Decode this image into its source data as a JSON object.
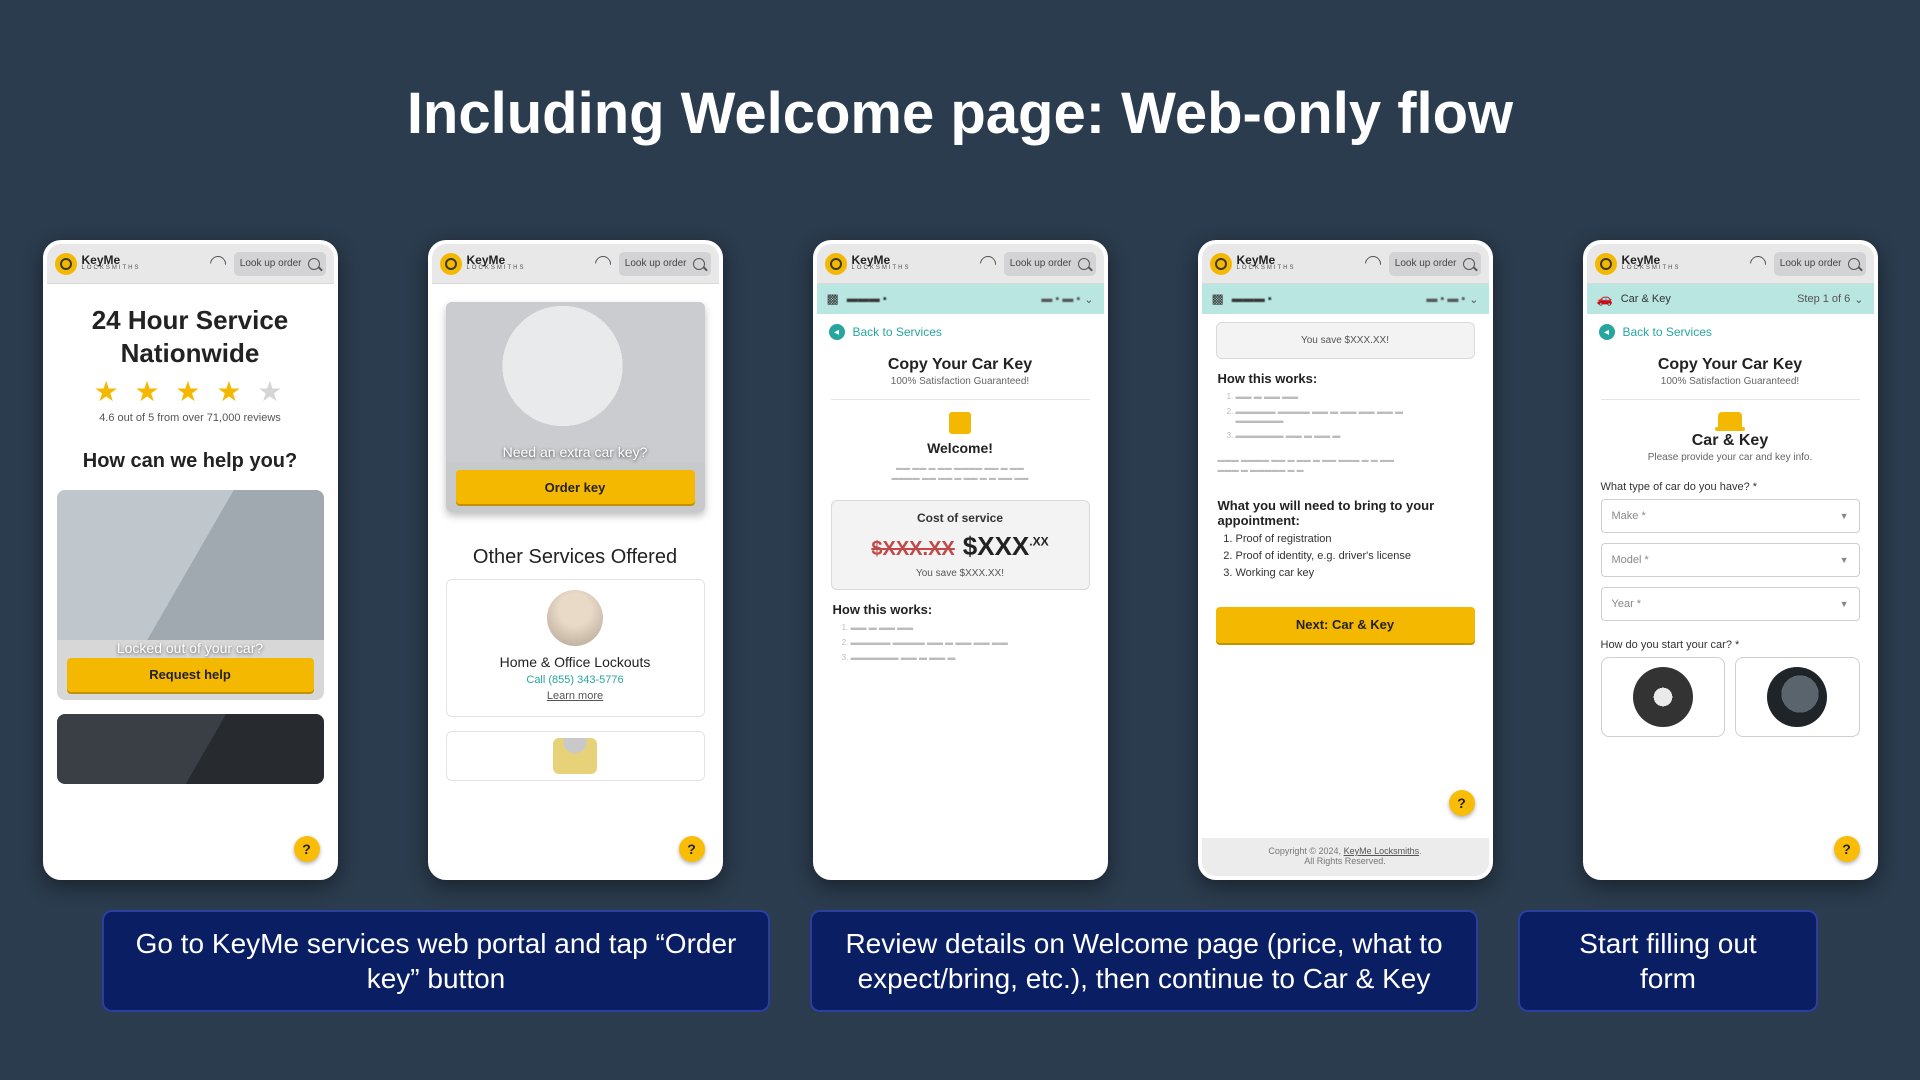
{
  "title": "Including Welcome page: Web-only flow",
  "brand": {
    "name": "KeyMe",
    "sub": "LOCKSMITHS"
  },
  "lookup": "Look up order",
  "screens": {
    "s1": {
      "hero_l1": "24 Hour Service",
      "hero_l2": "Nationwide",
      "rating_line": "4.6 out of 5 from over 71,000 reviews",
      "how": "How can we help you?",
      "card_label": "Locked out of your car?",
      "cta": "Request help"
    },
    "s2": {
      "q": "Need an extra car key?",
      "cta": "Order key",
      "other": "Other Services Offered",
      "tile": "Home & Office Lockouts",
      "call": "Call (855) 343-5776",
      "learn": "Learn more"
    },
    "s3": {
      "back": "Back to Services",
      "title": "Copy Your Car Key",
      "guarantee": "100% Satisfaction Guaranteed!",
      "welcome": "Welcome!",
      "cost_title": "Cost of service",
      "strike": "$XXX.XX",
      "price_main": "$XXX",
      "price_cents": ".XX",
      "save": "You save $XXX.XX!",
      "how": "How this works:"
    },
    "s4": {
      "save": "You save $XXX.XX!",
      "how": "How this works:",
      "bring": "What you will need to bring to your appointment:",
      "items": [
        "Proof of registration",
        "Proof of identity, e.g. driver's license",
        "Working car key"
      ],
      "next": "Next: Car & Key",
      "copyright": "Copyright © 2024, ",
      "brand_link": "KeyMe Locksmiths",
      "rights": "All Rights Reserved."
    },
    "s5": {
      "sub_title": "Car & Key",
      "step": "Step 1 of 6",
      "back": "Back to Services",
      "title": "Copy Your Car Key",
      "guarantee": "100% Satisfaction Guaranteed!",
      "section": "Car & Key",
      "desc": "Please provide your car and key info.",
      "q1": "What type of car do you have? *",
      "make": "Make *",
      "model": "Model *",
      "year": "Year *",
      "q2": "How do you start your car? *"
    }
  },
  "captions": {
    "c1": "Go to KeyMe services web portal and tap “Order key” button",
    "c2": "Review details on Welcome page (price, what to expect/bring, etc.), then continue to Car & Key",
    "c3": "Start filling out form"
  }
}
